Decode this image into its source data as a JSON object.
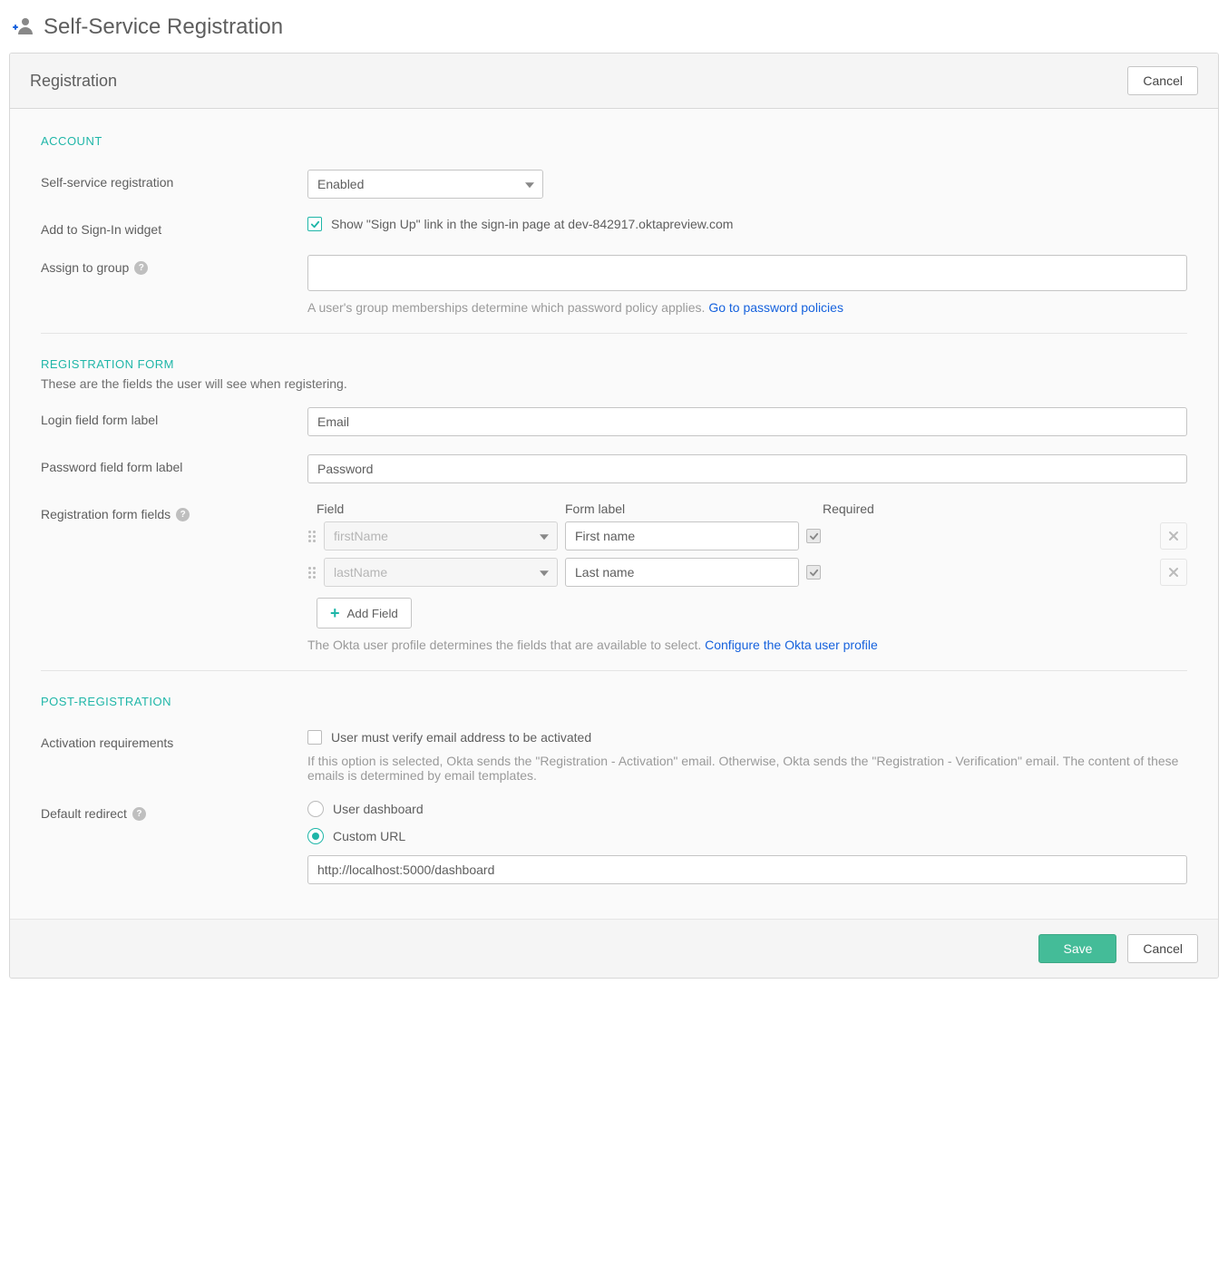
{
  "page": {
    "title": "Self-Service Registration"
  },
  "panel": {
    "header": "Registration",
    "cancel": "Cancel"
  },
  "account": {
    "title": "ACCOUNT",
    "ssr_label": "Self-service registration",
    "ssr_value": "Enabled",
    "widget_label": "Add to Sign-In widget",
    "widget_check_text": "Show \"Sign Up\" link in the sign-in page at dev-842917.oktapreview.com",
    "assign_label": "Assign to group",
    "assign_hint_text": "A user's group memberships determine which password policy applies. ",
    "assign_hint_link": "Go to password policies"
  },
  "regform": {
    "title": "REGISTRATION FORM",
    "desc": "These are the fields the user will see when registering.",
    "login_label": "Login field form label",
    "login_value": "Email",
    "password_label": "Password field form label",
    "password_value": "Password",
    "fields_label": "Registration form fields",
    "head_field": "Field",
    "head_form_label": "Form label",
    "head_required": "Required",
    "rows": [
      {
        "field": "firstName",
        "formLabel": "First name"
      },
      {
        "field": "lastName",
        "formLabel": "Last name"
      }
    ],
    "add_field": "Add Field",
    "hint_text": "The Okta user profile determines the fields that are available to select. ",
    "hint_link": "Configure the Okta user profile"
  },
  "postreg": {
    "title": "POST-REGISTRATION",
    "activation_label": "Activation requirements",
    "activation_check_text": "User must verify email address to be activated",
    "activation_hint": "If this option is selected, Okta sends the \"Registration - Activation\" email. Otherwise, Okta sends the \"Registration - Verification\" email. The content of these emails is determined by email templates.",
    "redirect_label": "Default redirect",
    "redirect_options": {
      "dashboard": "User dashboard",
      "custom": "Custom URL"
    },
    "redirect_url": "http://localhost:5000/dashboard"
  },
  "footer": {
    "save": "Save",
    "cancel": "Cancel"
  }
}
